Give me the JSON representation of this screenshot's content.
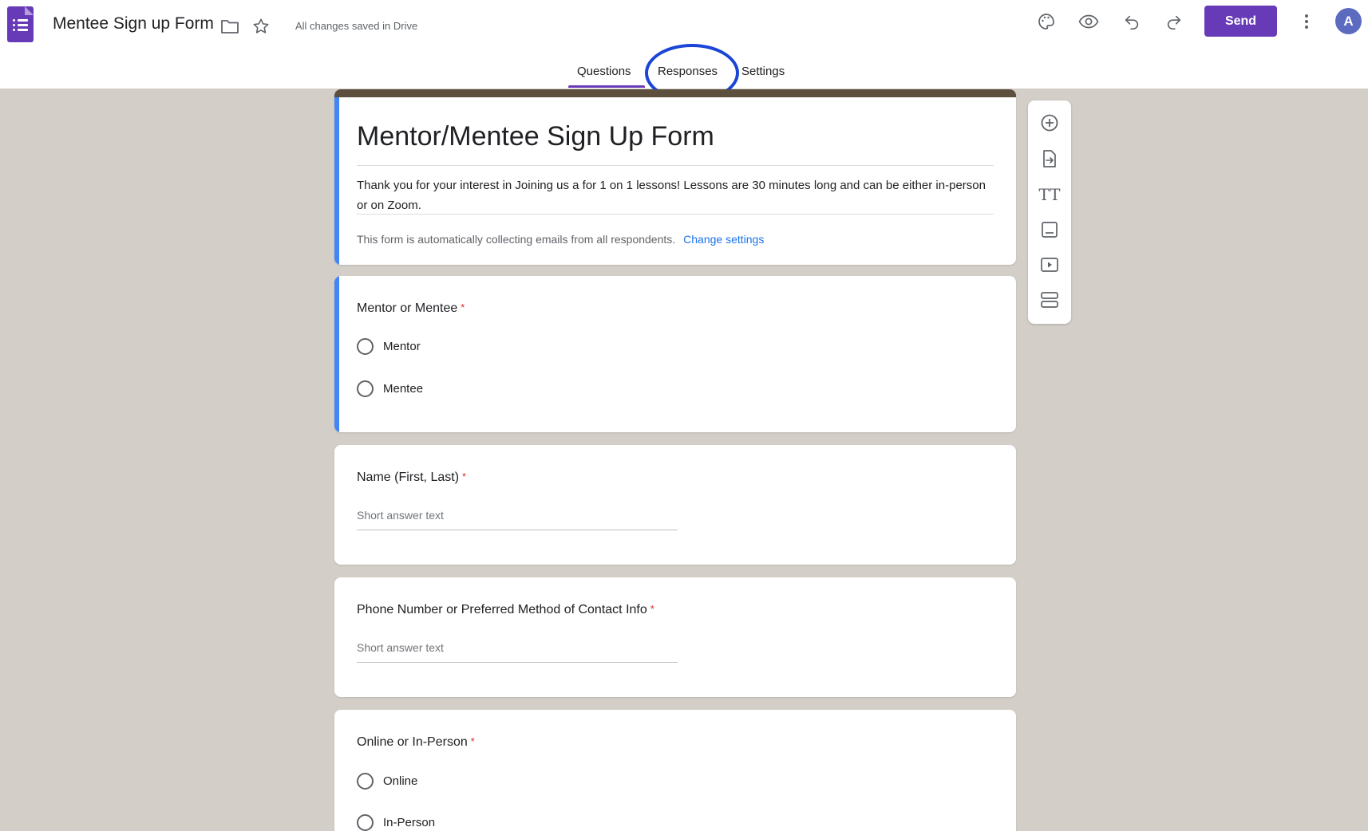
{
  "header": {
    "doc_title": "Mentee Sign up Form",
    "saved_status": "All changes saved in Drive",
    "send_label": "Send",
    "avatar_initial": "A",
    "icons": [
      "forms-logo-icon",
      "folder-icon",
      "star-icon",
      "palette-icon",
      "eye-icon",
      "undo-icon",
      "redo-icon",
      "more-vert-icon"
    ]
  },
  "tabs": [
    {
      "label": "Questions",
      "active": true
    },
    {
      "label": "Responses",
      "active": false
    },
    {
      "label": "Settings",
      "active": false
    }
  ],
  "form": {
    "title": "Mentor/Mentee Sign Up Form",
    "description": "Thank you for your interest in Joining us a for 1 on 1 lessons! Lessons are 30 minutes long and can be either in-person or on Zoom.",
    "collect_note": "This form is automatically collecting emails from all respondents.",
    "collect_link": "Change settings"
  },
  "questions": [
    {
      "title": "Mentor or Mentee",
      "required": "*",
      "type": "radio",
      "options": [
        "Mentor",
        "Mentee"
      ]
    },
    {
      "title": "Name (First, Last)",
      "required": "*",
      "type": "short",
      "placeholder": "Short answer text"
    },
    {
      "title": "Phone Number or Preferred Method of Contact Info",
      "required": "*",
      "type": "short",
      "placeholder": "Short answer text"
    },
    {
      "title": "Online or In-Person",
      "required": "*",
      "type": "radio",
      "options": [
        "Online",
        "In-Person"
      ]
    }
  ],
  "toolbar": {
    "tools": [
      "add-question-icon",
      "import-questions-icon",
      "add-title-icon",
      "add-image-icon",
      "add-video-icon",
      "add-section-icon"
    ],
    "title_glyph": "TT"
  },
  "colors": {
    "accent": "#673ab7",
    "active_bar": "#4285f4",
    "background": "#d3cfc8",
    "link": "#1a73e8",
    "required": "#d93025",
    "annotation_circle": "#1a45d6"
  }
}
